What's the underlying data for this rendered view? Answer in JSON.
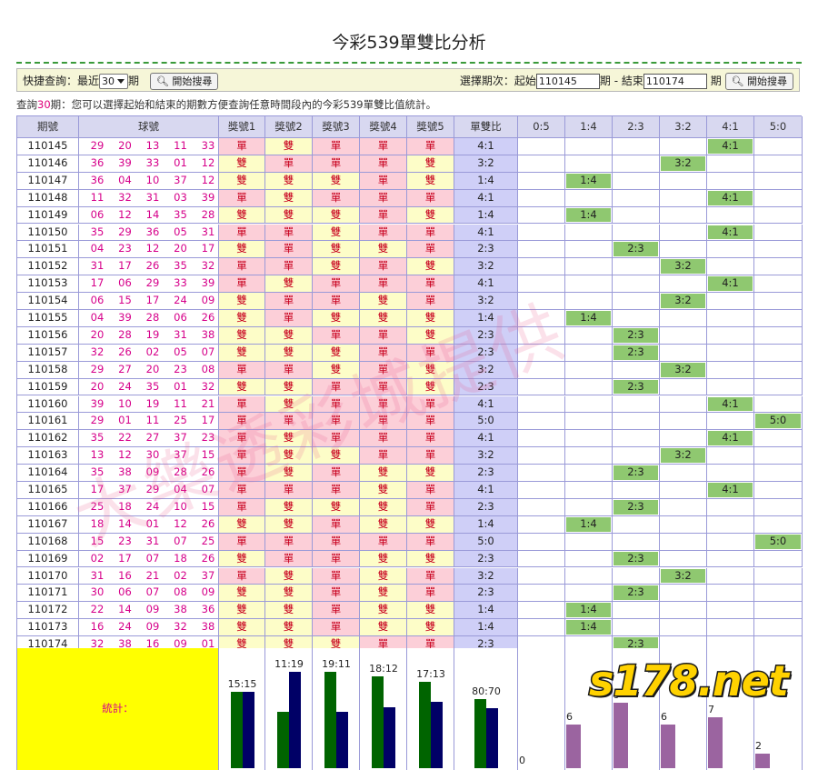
{
  "title": "今彩539單雙比分析",
  "query": {
    "quick_label": "快捷查詢：最近",
    "recent_value": "30",
    "period_unit": "期",
    "search_label": "開始搜尋",
    "range_label": "選擇期次：起始",
    "start_value": "110145",
    "mid_label": "期 - 結束",
    "end_value": "110174",
    "end_unit": "期"
  },
  "info": {
    "prefix": "查詢",
    "count": "30",
    "suffix": "期：您可以選擇起始和結束的期數方便查詢任意時間段內的今彩539單雙比值統計。"
  },
  "headers": [
    "期號",
    "球號",
    "獎號1",
    "獎號2",
    "獎號3",
    "獎號4",
    "獎號5",
    "單雙比",
    "0:5",
    "1:4",
    "2:3",
    "3:2",
    "4:1",
    "5:0"
  ],
  "parity_labels": {
    "odd": "單",
    "even": "雙"
  },
  "distribution_keys": [
    "0:5",
    "1:4",
    "2:3",
    "3:2",
    "4:1",
    "5:0"
  ],
  "rows": [
    {
      "period": "110145",
      "balls": [
        "29",
        "20",
        "13",
        "11",
        "33"
      ],
      "ratio": "4:1"
    },
    {
      "period": "110146",
      "balls": [
        "36",
        "39",
        "33",
        "01",
        "12"
      ],
      "ratio": "3:2"
    },
    {
      "period": "110147",
      "balls": [
        "36",
        "04",
        "10",
        "37",
        "12"
      ],
      "ratio": "1:4"
    },
    {
      "period": "110148",
      "balls": [
        "11",
        "32",
        "31",
        "03",
        "39"
      ],
      "ratio": "4:1"
    },
    {
      "period": "110149",
      "balls": [
        "06",
        "12",
        "14",
        "35",
        "28"
      ],
      "ratio": "1:4"
    },
    {
      "period": "110150",
      "balls": [
        "35",
        "29",
        "36",
        "05",
        "31"
      ],
      "ratio": "4:1"
    },
    {
      "period": "110151",
      "balls": [
        "04",
        "23",
        "12",
        "20",
        "17"
      ],
      "ratio": "2:3"
    },
    {
      "period": "110152",
      "balls": [
        "31",
        "17",
        "26",
        "35",
        "32"
      ],
      "ratio": "3:2"
    },
    {
      "period": "110153",
      "balls": [
        "17",
        "06",
        "29",
        "33",
        "39"
      ],
      "ratio": "4:1"
    },
    {
      "period": "110154",
      "balls": [
        "06",
        "15",
        "17",
        "24",
        "09"
      ],
      "ratio": "3:2"
    },
    {
      "period": "110155",
      "balls": [
        "04",
        "39",
        "28",
        "06",
        "26"
      ],
      "ratio": "1:4"
    },
    {
      "period": "110156",
      "balls": [
        "20",
        "28",
        "19",
        "31",
        "38"
      ],
      "ratio": "2:3"
    },
    {
      "period": "110157",
      "balls": [
        "32",
        "26",
        "02",
        "05",
        "07"
      ],
      "ratio": "2:3"
    },
    {
      "period": "110158",
      "balls": [
        "29",
        "27",
        "20",
        "23",
        "08"
      ],
      "ratio": "3:2"
    },
    {
      "period": "110159",
      "balls": [
        "20",
        "24",
        "35",
        "01",
        "32"
      ],
      "ratio": "2:3"
    },
    {
      "period": "110160",
      "balls": [
        "39",
        "10",
        "19",
        "11",
        "21"
      ],
      "ratio": "4:1"
    },
    {
      "period": "110161",
      "balls": [
        "29",
        "01",
        "11",
        "25",
        "17"
      ],
      "ratio": "5:0"
    },
    {
      "period": "110162",
      "balls": [
        "35",
        "22",
        "27",
        "37",
        "23"
      ],
      "ratio": "4:1"
    },
    {
      "period": "110163",
      "balls": [
        "13",
        "12",
        "30",
        "37",
        "15"
      ],
      "ratio": "3:2"
    },
    {
      "period": "110164",
      "balls": [
        "35",
        "38",
        "09",
        "28",
        "26"
      ],
      "ratio": "2:3"
    },
    {
      "period": "110165",
      "balls": [
        "17",
        "37",
        "29",
        "04",
        "07"
      ],
      "ratio": "4:1"
    },
    {
      "period": "110166",
      "balls": [
        "25",
        "18",
        "24",
        "10",
        "15"
      ],
      "ratio": "2:3"
    },
    {
      "period": "110167",
      "balls": [
        "18",
        "14",
        "01",
        "12",
        "26"
      ],
      "ratio": "1:4"
    },
    {
      "period": "110168",
      "balls": [
        "15",
        "23",
        "31",
        "07",
        "25"
      ],
      "ratio": "5:0"
    },
    {
      "period": "110169",
      "balls": [
        "02",
        "17",
        "07",
        "18",
        "26"
      ],
      "ratio": "2:3"
    },
    {
      "period": "110170",
      "balls": [
        "31",
        "16",
        "21",
        "02",
        "37"
      ],
      "ratio": "3:2"
    },
    {
      "period": "110171",
      "balls": [
        "30",
        "06",
        "07",
        "08",
        "09"
      ],
      "ratio": "2:3"
    },
    {
      "period": "110172",
      "balls": [
        "22",
        "14",
        "09",
        "38",
        "36"
      ],
      "ratio": "1:4"
    },
    {
      "period": "110173",
      "balls": [
        "16",
        "24",
        "09",
        "32",
        "38"
      ],
      "ratio": "1:4"
    },
    {
      "period": "110174",
      "balls": [
        "32",
        "38",
        "16",
        "09",
        "01"
      ],
      "ratio": "2:3"
    }
  ],
  "stats": {
    "label": "統計：",
    "positions": [
      {
        "label": "15:15",
        "odd": 15,
        "even": 15
      },
      {
        "label": "11:19",
        "odd": 11,
        "even": 19
      },
      {
        "label": "19:11",
        "odd": 19,
        "even": 11
      },
      {
        "label": "18:12",
        "odd": 18,
        "even": 12
      },
      {
        "label": "17:13",
        "odd": 17,
        "even": 13
      }
    ],
    "total": {
      "label": "80:70",
      "odd": 80,
      "even": 70
    },
    "distribution": [
      {
        "key": "0:5",
        "count": "0"
      },
      {
        "key": "1:4",
        "count": "6"
      },
      {
        "key": "2:3",
        "count": "9"
      },
      {
        "key": "3:2",
        "count": "6"
      },
      {
        "key": "4:1",
        "count": "7"
      },
      {
        "key": "5:0",
        "count": "2"
      }
    ]
  },
  "logo": "s178.net",
  "watermark": "大樂透彩城提供",
  "colors": {
    "odd_bar": "#006400",
    "even_bar": "#000066",
    "dist_bar": "#9b64a0",
    "mark": "#8fc870"
  }
}
